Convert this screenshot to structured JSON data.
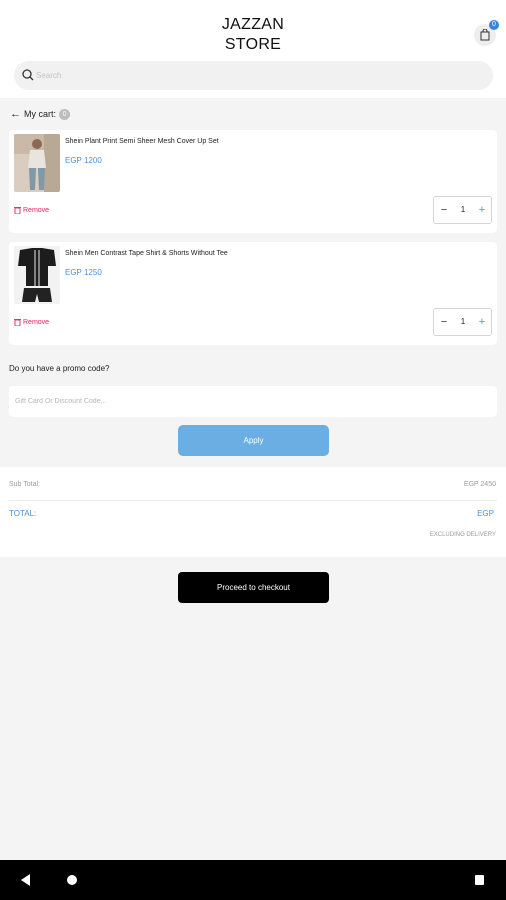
{
  "header": {
    "brand_line1": "JAZZAN",
    "brand_line2": "STORE",
    "bag_count": "0"
  },
  "search": {
    "placeholder": "Search",
    "value": ""
  },
  "cart": {
    "title": "My cart",
    "count": "0",
    "items": [
      {
        "name": "Shein Plant Print Semi Sheer Mesh Cover Up Set",
        "price": "EGP 1200",
        "quantity": "1",
        "remove_label": "Remove",
        "image_icon": "product-photo-beige-coverup"
      },
      {
        "name": "Shein Men Contrast Tape Shirt & Shorts Without Tee",
        "price": "EGP 1250",
        "quantity": "1",
        "remove_label": "Remove",
        "image_icon": "product-photo-black-shirt-shorts"
      }
    ]
  },
  "promo": {
    "label": "Do you have a promo code?",
    "placeholder": "Gift Card Or Discount Code...",
    "value": "",
    "apply_label": "Apply"
  },
  "totals": {
    "subtotal_label": "Sub Total:",
    "subtotal_value": "EGP 2450",
    "total_label": "TOTAL:",
    "total_value": "EGP",
    "delivery_note": "EXCLUDING DELIVERY"
  },
  "checkout": {
    "label": "Proceed to checkout"
  },
  "colors": {
    "accent": "#4a90d9",
    "apply_button": "#6aaee4",
    "remove": "#e0245e",
    "checkout_button": "#000000"
  }
}
